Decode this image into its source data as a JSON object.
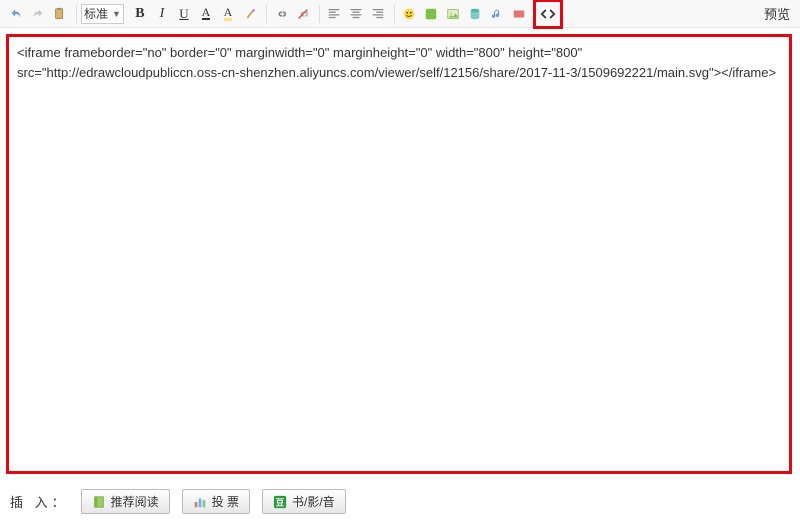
{
  "toolbar": {
    "undo_icon": "undo",
    "redo_icon": "redo",
    "paste_icon": "paste",
    "style_select": "标准",
    "bold": "B",
    "italic": "I",
    "underline": "U",
    "fontcolor": "A",
    "bgcolor": "A",
    "magic": "wand",
    "link": "link",
    "unlink": "unlink",
    "align_left": "al",
    "align_center": "ac",
    "align_right": "ar",
    "emoji_icon": "emoji",
    "record_icon": "rec",
    "image_icon": "img",
    "db_icon": "db",
    "music_icon": "music",
    "red_icon": "flag",
    "code_icon": "code",
    "preview_label": "预览"
  },
  "editor": {
    "content": "<iframe frameborder=\"no\" border=\"0\" marginwidth=\"0\" marginheight=\"0\" width=\"800\" height=\"800\" src=\"http://edrawcloudpubliccn.oss-cn-shenzhen.aliyuncs.com/viewer/self/12156/share/2017-11-3/1509692221/main.svg\"></iframe>"
  },
  "bottom": {
    "insert_label": "插 入：",
    "btn_recommend": "推荐阅读",
    "btn_vote": "投 票",
    "btn_media": "书/影/音"
  }
}
